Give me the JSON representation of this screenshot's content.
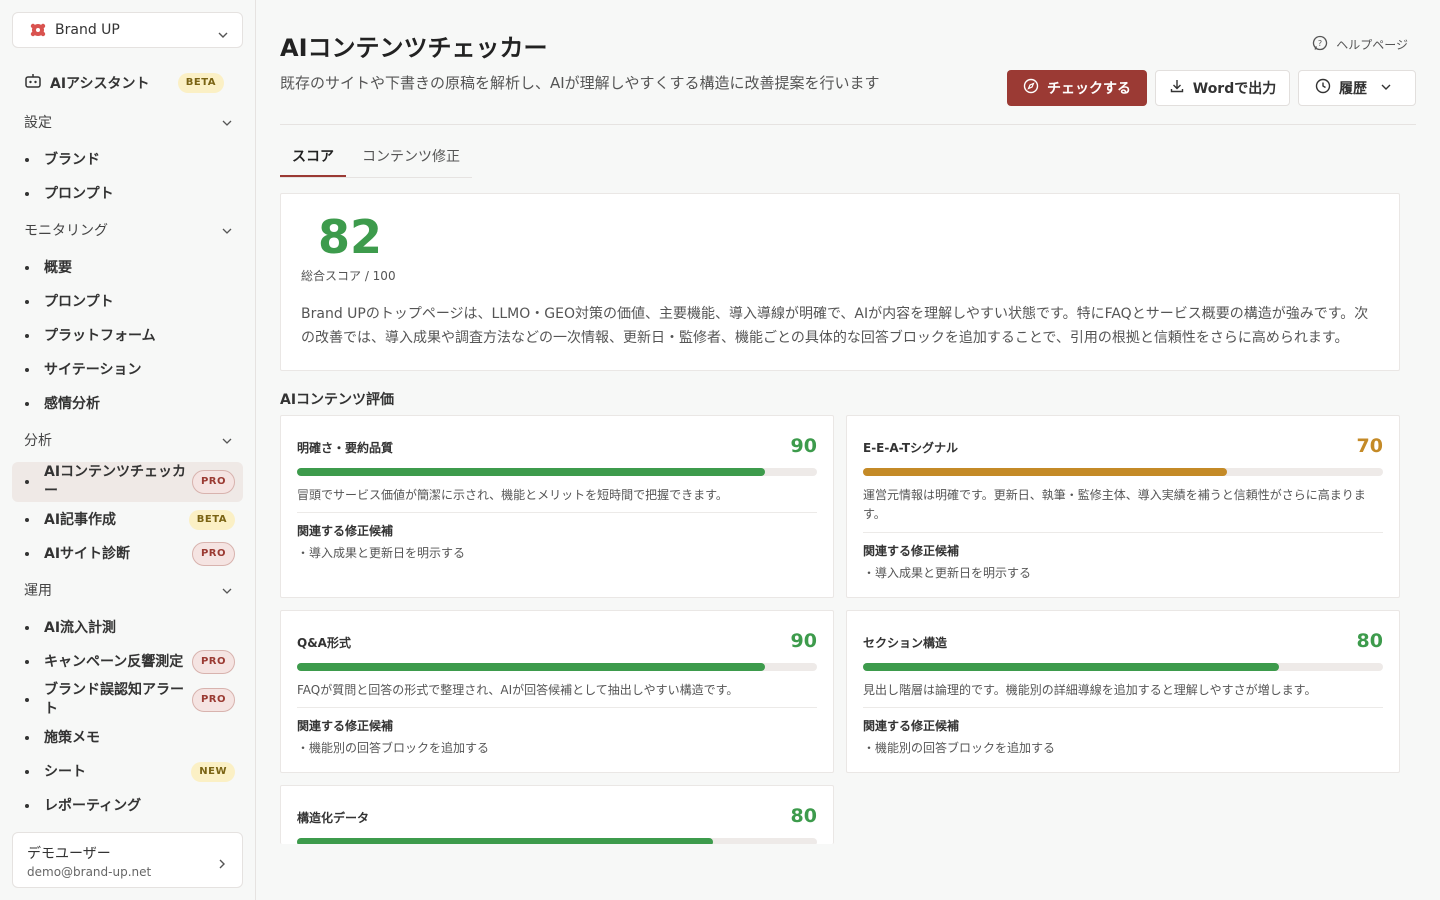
{
  "sidebar": {
    "brand": "Brand UP",
    "assistant": {
      "label": "AIアシスタント",
      "badge": "BETA"
    },
    "sections": [
      {
        "label": "設定",
        "items": [
          {
            "label": "ブランド"
          },
          {
            "label": "プロンプト"
          }
        ]
      },
      {
        "label": "モニタリング",
        "items": [
          {
            "label": "概要"
          },
          {
            "label": "プロンプト"
          },
          {
            "label": "プラットフォーム"
          },
          {
            "label": "サイテーション"
          },
          {
            "label": "感情分析"
          }
        ]
      },
      {
        "label": "分析",
        "items": [
          {
            "label": "AIコンテンツチェッカー",
            "badge": "PRO"
          },
          {
            "label": "AI記事作成",
            "badge": "BETA"
          },
          {
            "label": "AIサイト診断",
            "badge": "PRO"
          }
        ]
      },
      {
        "label": "運用",
        "items": [
          {
            "label": "AI流入計測"
          },
          {
            "label": "キャンペーン反響測定",
            "badge": "PRO"
          },
          {
            "label": "ブランド誤認知アラート",
            "badge": "PRO"
          },
          {
            "label": "施策メモ"
          },
          {
            "label": "シート",
            "badge": "NEW"
          },
          {
            "label": "レポーティング"
          }
        ]
      }
    ],
    "user": {
      "name": "デモユーザー",
      "email": "demo@brand-up.net"
    }
  },
  "header": {
    "title": "AIコンテンツチェッカー",
    "description": "既存のサイトや下書きの原稿を解析し、AIが理解しやすくする構造に改善提案を行います",
    "help": "ヘルプページ",
    "check_button": "チェックする",
    "word_button": "Wordで出力",
    "history_button": "履歴"
  },
  "tabs": [
    {
      "label": "スコア"
    },
    {
      "label": "コンテンツ修正"
    }
  ],
  "score": {
    "value": "82",
    "caption": "総合スコア / 100",
    "summary": "Brand UPのトップページは、LLMO・GEO対策の価値、主要機能、導入導線が明確で、AIが内容を理解しやすい状態です。特にFAQとサービス概要の構造が強みです。次の改善では、導入成果や調査方法などの一次情報、更新日・監修者、機能ごとの具体的な回答ブロックを追加することで、引用の根拠と信頼性をさらに高められます。"
  },
  "evaluation": {
    "heading": "AIコンテンツ評価",
    "related_label": "関連する修正候補",
    "cards": [
      {
        "title": "明確さ・要約品質",
        "score": 90,
        "score_text": "90",
        "color": "#3d9b4c",
        "description": "冒頭でサービス価値が簡潔に示され、機能とメリットを短時間で把握できます。",
        "fix": "・導入成果と更新日を明示する"
      },
      {
        "title": "E-E-A-Tシグナル",
        "score": 70,
        "score_text": "70",
        "color": "#c48a27",
        "description": "運営元情報は明確です。更新日、執筆・監修主体、導入実績を補うと信頼性がさらに高まります。",
        "fix": "・導入成果と更新日を明示する"
      },
      {
        "title": "Q&A形式",
        "score": 90,
        "score_text": "90",
        "color": "#3d9b4c",
        "description": "FAQが質問と回答の形式で整理され、AIが回答候補として抽出しやすい構造です。",
        "fix": "・機能別の回答ブロックを追加する"
      },
      {
        "title": "セクション構造",
        "score": 80,
        "score_text": "80",
        "color": "#3d9b4c",
        "description": "見出し階層は論理的です。機能別の詳細導線を追加すると理解しやすさが増します。",
        "fix": "・機能別の回答ブロックを追加する"
      },
      {
        "title": "構造化データ",
        "score": 80,
        "score_text": "80",
        "color": "#3d9b4c",
        "description": "",
        "fix": ""
      }
    ]
  }
}
